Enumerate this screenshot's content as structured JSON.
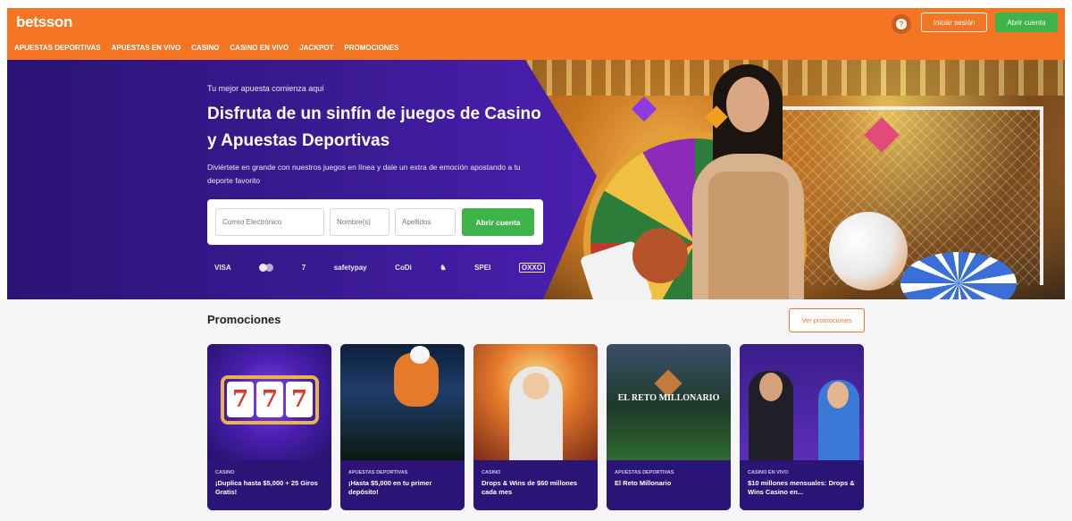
{
  "header": {
    "logo": "betsson",
    "nav": [
      "APUESTAS DEPORTIVAS",
      "APUESTAS EN VIVO",
      "CASINO",
      "CASINO EN VIVO",
      "JACKPOT",
      "PROMOCIONES"
    ],
    "login_label": "Iniciar sesión",
    "signup_label": "Abrir cuenta",
    "accent": "#f47524"
  },
  "hero": {
    "kicker": "Tu mejor apuesta comienza aquí",
    "title": "Disfruta de un sinfín de juegos de Casino y Apuestas Deportivas",
    "subtitle": "Diviértete en grande con nuestros juegos en línea y dale un extra de emoción apostando a tu deporte favorito",
    "form": {
      "email_placeholder": "Correo Electrónico",
      "name_placeholder": "Nombre(s)",
      "lastname_placeholder": "Apellidos",
      "submit_label": "Abrir cuenta"
    },
    "payments": [
      "VISA",
      "mastercard",
      "7",
      "safetypay",
      "CoDi",
      "bancomer",
      "SPEI",
      "OXXO"
    ]
  },
  "promotions": {
    "title": "Promociones",
    "all_label": "Ver promociones",
    "cards": [
      {
        "category": "CASINO",
        "text": "¡Duplica hasta $5,000 + 25 Giros Gratis!"
      },
      {
        "category": "APUESTAS DEPORTIVAS",
        "text": "¡Hasta $5,000 en tu primer depósito!"
      },
      {
        "category": "CASINO",
        "text": "Drops & Wins de $60 millones cada mes"
      },
      {
        "category": "APUESTAS DEPORTIVAS",
        "text": "El Reto Millonario"
      },
      {
        "category": "CASINO EN VIVO",
        "text": "$10 millones mensuales: Drops & Wins Casino en..."
      }
    ],
    "card_image_texts": {
      "reto": "EL RETO MILLONARIO",
      "slot_symbol": "7"
    }
  }
}
